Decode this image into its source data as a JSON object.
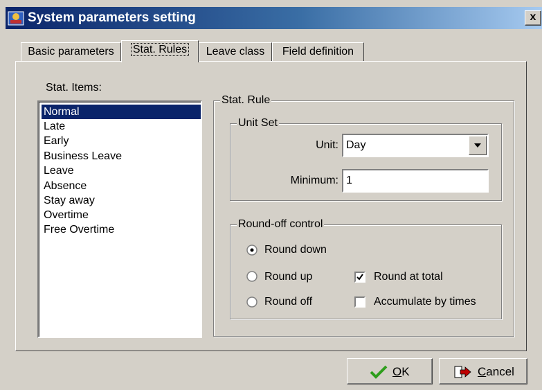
{
  "window": {
    "title": "System parameters setting",
    "close_label": "x"
  },
  "tabs": [
    {
      "label": "Basic parameters",
      "active": false
    },
    {
      "label": "Stat. Rules",
      "active": true
    },
    {
      "label": "Leave class",
      "active": false
    },
    {
      "label": "Field definition",
      "active": false
    }
  ],
  "stat_items": {
    "label": "Stat. Items:",
    "items": [
      "Normal",
      "Late",
      "Early",
      "Business Leave",
      "Leave",
      "Absence",
      "Stay away",
      "Overtime",
      "Free Overtime"
    ],
    "selected": "Normal"
  },
  "stat_rule": {
    "legend": "Stat. Rule",
    "unit_set": {
      "legend": "Unit Set",
      "unit_label": "Unit:",
      "unit_value": "Day",
      "minimum_label": "Minimum:",
      "minimum_value": "1"
    },
    "round_off": {
      "legend": "Round-off control",
      "round_down": "Round down",
      "round_up": "Round up",
      "round_off": "Round off",
      "selected": "Round down",
      "round_at_total": "Round at total",
      "round_at_total_checked": true,
      "accumulate_by_times": "Accumulate by times",
      "accumulate_by_times_checked": false
    }
  },
  "buttons": {
    "ok_mnemonic": "O",
    "ok_rest": "K",
    "cancel_mnemonic": "C",
    "cancel_rest": "ancel"
  },
  "colors": {
    "selection": "#0a246a",
    "face": "#d4d0c8",
    "ok_check": "#2e9e1c",
    "cancel_arrow": "#c00000"
  },
  "icons": {
    "app": "app-icon",
    "ok": "checkmark-icon",
    "cancel": "exit-door-arrow-icon",
    "dropdown": "chevron-down-icon"
  }
}
